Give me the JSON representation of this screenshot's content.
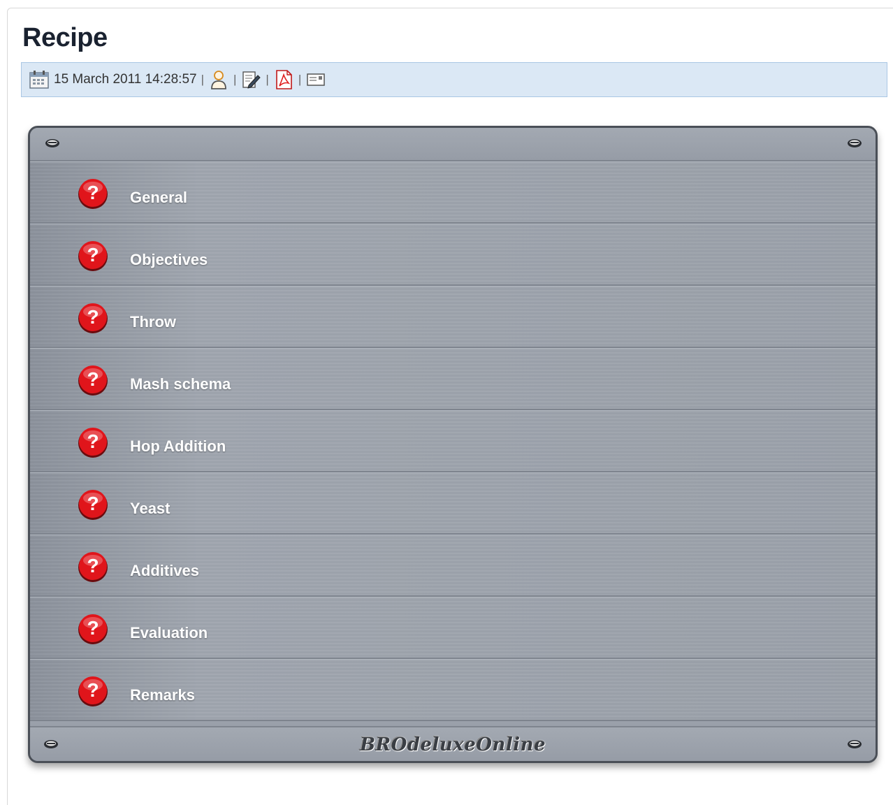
{
  "page": {
    "title": "Recipe"
  },
  "meta": {
    "date": "15 March 2011 14:28:57",
    "separator": "|",
    "icons": [
      "calendar-icon",
      "user-icon",
      "edit-icon",
      "pdf-icon",
      "email-icon"
    ]
  },
  "panel": {
    "brand": "BROdeluxeOnline",
    "sections": [
      {
        "label": "General",
        "icon": "help-icon"
      },
      {
        "label": "Objectives",
        "icon": "help-icon"
      },
      {
        "label": "Throw",
        "icon": "help-icon"
      },
      {
        "label": "Mash schema",
        "icon": "help-icon"
      },
      {
        "label": "Hop Addition",
        "icon": "help-icon"
      },
      {
        "label": "Yeast",
        "icon": "help-icon"
      },
      {
        "label": "Additives",
        "icon": "help-icon"
      },
      {
        "label": "Evaluation",
        "icon": "help-icon"
      },
      {
        "label": "Remarks",
        "icon": "help-icon"
      }
    ]
  },
  "colors": {
    "panel_bg": "#9aa0aa",
    "meta_bar_bg": "#dbe8f5",
    "help_icon_red": "#e0151b",
    "title": "#1a2230"
  }
}
